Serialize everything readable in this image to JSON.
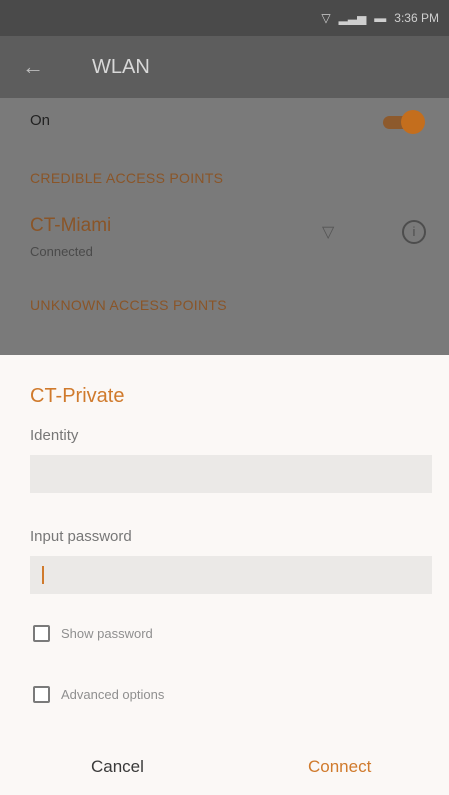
{
  "status_bar": {
    "time": "3:36 PM",
    "icons": [
      "wifi-icon",
      "signal-icon",
      "battery-icon"
    ]
  },
  "toolbar": {
    "back_icon": "arrow-left-icon",
    "title": "WLAN"
  },
  "wlan_toggle": {
    "label": "On",
    "state": "on"
  },
  "sections": {
    "credible": "CREDIBLE ACCESS POINTS",
    "unknown": "UNKNOWN ACCESS POINTS"
  },
  "connected_network": {
    "name": "CT-Miami",
    "status": "Connected"
  },
  "dialog": {
    "title": "CT-Private",
    "identity_label": "Identity",
    "identity_value": "",
    "password_label": "Input password",
    "password_value": "",
    "show_password_label": "Show password",
    "advanced_options_label": "Advanced options",
    "cancel_label": "Cancel",
    "connect_label": "Connect"
  },
  "colors": {
    "accent": "#d07a2c",
    "dialog_bg": "#fbf8f6",
    "input_bg": "#ebe9e7",
    "scrim": "#777777"
  }
}
